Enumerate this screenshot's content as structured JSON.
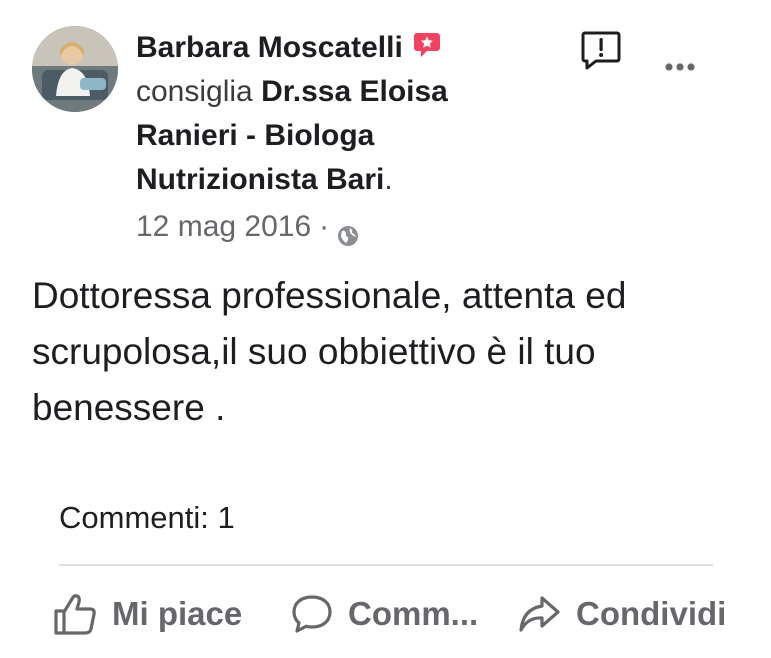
{
  "post": {
    "author": "Barbara Moscatelli",
    "verb": "consiglia",
    "page_name": "Dr.ssa Eloisa Ranieri - Biologa Nutrizionista Bari",
    "period": ".",
    "date": "12 mag 2016",
    "dot": "·",
    "text": "Dottoressa professionale, attenta ed scrupolosa,il suo obbiettivo è il tuo benessere ."
  },
  "stats": {
    "comments": "Commenti: 1"
  },
  "actions": {
    "like": "Mi piace",
    "comment": "Comm...",
    "share": "Condividi"
  },
  "icons": {
    "badge": "recommendation-badge-icon",
    "privacy": "globe-icon",
    "report": "report-icon",
    "more": "more-options-icon",
    "like": "thumbs-up-icon",
    "comment": "comment-bubble-icon",
    "share": "share-arrow-icon"
  },
  "colors": {
    "badge": "#f3425f",
    "secondary_text": "#65676b",
    "primary_text": "#1c1e21",
    "divider": "#dadde1"
  }
}
